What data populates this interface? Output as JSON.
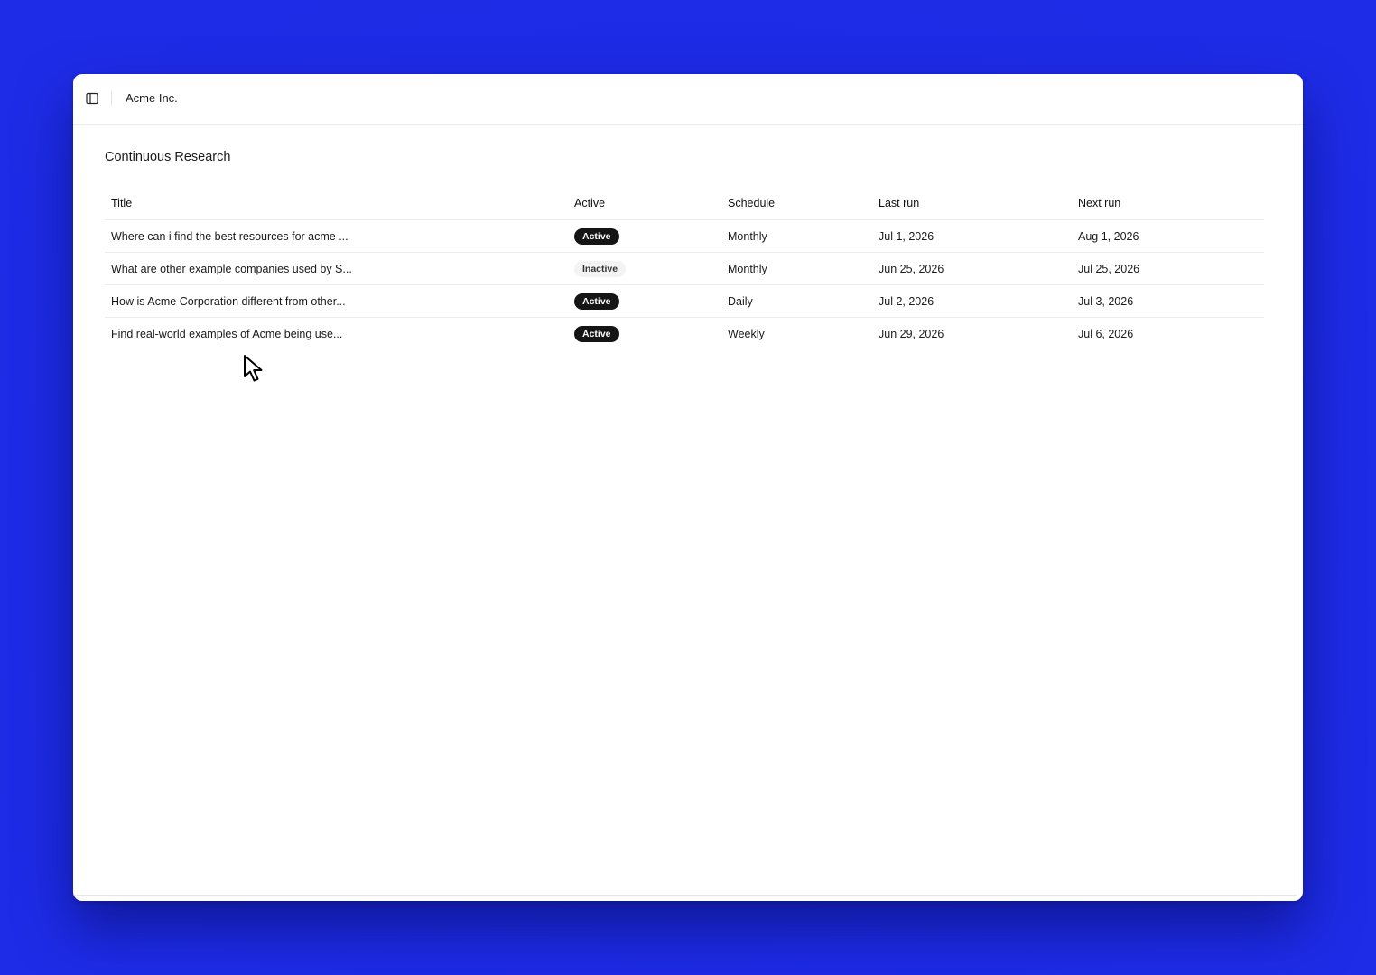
{
  "app": {
    "breadcrumb": "Acme Inc."
  },
  "page": {
    "title": "Continuous Research"
  },
  "table": {
    "columns": {
      "title": "Title",
      "active": "Active",
      "schedule": "Schedule",
      "last_run": "Last run",
      "next_run": "Next run"
    },
    "rows": [
      {
        "title": "Where can i find the best resources for acme ...",
        "status": "Active",
        "schedule": "Monthly",
        "last_run": "Jul 1, 2026",
        "next_run": "Aug 1, 2026"
      },
      {
        "title": "What are other example companies used by S...",
        "status": "Inactive",
        "schedule": "Monthly",
        "last_run": "Jun 25, 2026",
        "next_run": "Jul 25, 2026"
      },
      {
        "title": "How is Acme Corporation different from other...",
        "status": "Active",
        "schedule": "Daily",
        "last_run": "Jul 2, 2026",
        "next_run": "Jul 3, 2026"
      },
      {
        "title": "Find real-world examples of Acme being use...",
        "status": "Active",
        "schedule": "Weekly",
        "last_run": "Jun 29, 2026",
        "next_run": "Jul 6, 2026"
      }
    ]
  },
  "colors": {
    "background": "#1e2ce6",
    "badge_active_bg": "#151515",
    "badge_inactive_bg": "#f3f3f3"
  },
  "icons": {
    "sidebar_toggle": "sidebar-panel-icon",
    "cursor": "mouse-pointer-arrow"
  }
}
